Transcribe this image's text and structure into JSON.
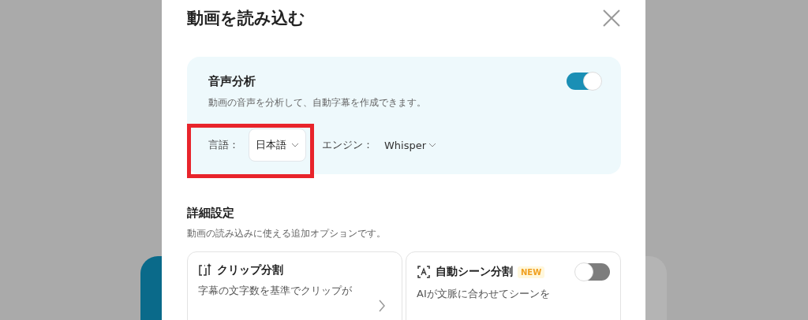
{
  "dialog": {
    "title": "動画を読み込む"
  },
  "audio_analysis": {
    "title": "音声分析",
    "description": "動画の音声を分析して、自動字幕を作成できます。",
    "on": true,
    "language": {
      "label": "言語：",
      "value": "日本語"
    },
    "engine": {
      "label": "エンジン：",
      "value": "Whisper"
    },
    "highlighted": true
  },
  "advanced": {
    "title": "詳細設定",
    "description": "動画の読み込みに使える追加オプションです。",
    "options": [
      {
        "kind": "link",
        "title": "クリップ分割",
        "description": "字幕の文字数を基準でクリップが"
      },
      {
        "kind": "toggle",
        "title": "自動シーン分割",
        "badge": "NEW",
        "on": false,
        "description": "AIが文脈に合わせてシーンを"
      }
    ]
  }
}
